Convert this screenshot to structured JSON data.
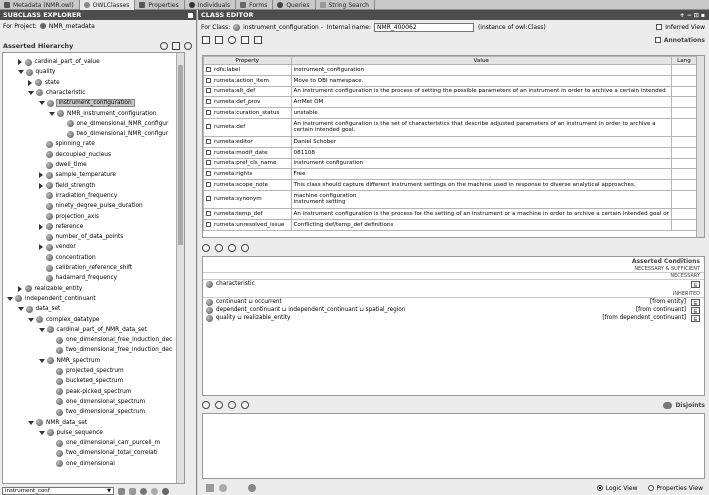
{
  "tabs": [
    {
      "label": "Metadata (NMR.owl)",
      "active": false,
      "icon": "metadata-icon"
    },
    {
      "label": "OWLClasses",
      "active": true,
      "icon": "owlclasses-icon"
    },
    {
      "label": "Properties",
      "active": false,
      "icon": "properties-icon"
    },
    {
      "label": "Individuals",
      "active": false,
      "icon": "individuals-icon"
    },
    {
      "label": "Forms",
      "active": false,
      "icon": "forms-icon"
    },
    {
      "label": "Queries",
      "active": false,
      "icon": "queries-icon"
    },
    {
      "label": "String Search",
      "active": false,
      "icon": "string-search-icon"
    }
  ],
  "left": {
    "title": "SUBCLASS EXPLORER",
    "project_label": "For Project:",
    "project_name": "NMR_metadata",
    "hierarchy_label": "Asserted Hierarchy",
    "search_value": "instrument_conf",
    "tree": [
      {
        "label": "cardinal_part_of_value",
        "depth": 2,
        "toggle": "c"
      },
      {
        "label": "quality",
        "depth": 2,
        "toggle": "e"
      },
      {
        "label": "state",
        "depth": 3,
        "toggle": "c"
      },
      {
        "label": "characteristic",
        "depth": 3,
        "toggle": "e"
      },
      {
        "label": "instrument_configuration",
        "depth": 4,
        "toggle": "e",
        "selected": true
      },
      {
        "label": "NMR_instrument_configuration",
        "depth": 5,
        "toggle": "e"
      },
      {
        "label": "one_dimensional_NMR_configur",
        "depth": 6,
        "toggle": "n"
      },
      {
        "label": "two_dimensional_NMR_configur",
        "depth": 6,
        "toggle": "n"
      },
      {
        "label": "spinning_rate",
        "depth": 4,
        "toggle": "n"
      },
      {
        "label": "decoupled_nucleus",
        "depth": 4,
        "toggle": "n"
      },
      {
        "label": "dwell_time",
        "depth": 4,
        "toggle": "n"
      },
      {
        "label": "sample_temperature",
        "depth": 4,
        "toggle": "c"
      },
      {
        "label": "field_strength",
        "depth": 4,
        "toggle": "c"
      },
      {
        "label": "irradiation_frequency",
        "depth": 4,
        "toggle": "n"
      },
      {
        "label": "ninety_degree_pulse_duration",
        "depth": 4,
        "toggle": "n"
      },
      {
        "label": "projection_axis",
        "depth": 4,
        "toggle": "n"
      },
      {
        "label": "reference",
        "depth": 4,
        "toggle": "c"
      },
      {
        "label": "number_of_data_points",
        "depth": 4,
        "toggle": "n"
      },
      {
        "label": "vendor",
        "depth": 4,
        "toggle": "c"
      },
      {
        "label": "concentration",
        "depth": 4,
        "toggle": "n"
      },
      {
        "label": "calibration_reference_shift",
        "depth": 4,
        "toggle": "n"
      },
      {
        "label": "hadamard_frequency",
        "depth": 4,
        "toggle": "n"
      },
      {
        "label": "realizable_entity",
        "depth": 2,
        "toggle": "c"
      },
      {
        "label": "independent_continuant",
        "depth": 1,
        "toggle": "e"
      },
      {
        "label": "data_set",
        "depth": 2,
        "toggle": "e"
      },
      {
        "label": "complex_datatype",
        "depth": 3,
        "toggle": "e"
      },
      {
        "label": "cardinal_part_of_NMR_data_set",
        "depth": 4,
        "toggle": "e"
      },
      {
        "label": "one_dimensional_free_induction_dec",
        "depth": 5,
        "toggle": "n"
      },
      {
        "label": "two_dimensional_free_induction_dec",
        "depth": 5,
        "toggle": "n"
      },
      {
        "label": "NMR_spectrum",
        "depth": 4,
        "toggle": "e"
      },
      {
        "label": "projected_spectrum",
        "depth": 5,
        "toggle": "n"
      },
      {
        "label": "bucketed_spectrum",
        "depth": 5,
        "toggle": "n"
      },
      {
        "label": "peak-picked_spectrum",
        "depth": 5,
        "toggle": "n"
      },
      {
        "label": "one_dimensional_spectrum",
        "depth": 5,
        "toggle": "n"
      },
      {
        "label": "two_dimensional_spectrum",
        "depth": 5,
        "toggle": "n"
      },
      {
        "label": "NMR_data_set",
        "depth": 3,
        "toggle": "e"
      },
      {
        "label": "pulse_sequence",
        "depth": 4,
        "toggle": "e"
      },
      {
        "label": "one_dimensional_carr_purcell_m",
        "depth": 5,
        "toggle": "n"
      },
      {
        "label": "two_dimensional_total_correlati",
        "depth": 5,
        "toggle": "n"
      },
      {
        "label": "one_dimensional",
        "depth": 5,
        "toggle": "n"
      }
    ]
  },
  "right": {
    "title": "CLASS EDITOR",
    "for_class_label": "For Class:",
    "class_name": "instrument_configuration -",
    "internal_name_label": "Internal name:",
    "internal_name_value": "NMR_400062",
    "instance_of": "(instance of owl:Class)",
    "inferred_view_label": "Inferred View",
    "annotations_label": "Annotations",
    "columns": [
      "Property",
      "Value",
      "Lang"
    ],
    "annotations": [
      {
        "property": "rdfs:label",
        "value": [
          "instrument_configuration"
        ]
      },
      {
        "property": "rumeta:action_item",
        "value": [
          "Move to OBI namespace."
        ]
      },
      {
        "property": "rumeta:alt_def",
        "value": [
          "An instrument configuration is the process of setting the possible parameters of an instrument in order to archive a certain intended"
        ]
      },
      {
        "property": "rumeta:def_prov",
        "value": [
          "ArrMet OM"
        ]
      },
      {
        "property": "rumeta:curation_status",
        "value": [
          "unstable"
        ]
      },
      {
        "property": "rumeta:def",
        "value": [
          "An instrument configuration is the set of characteristics that describe adjusted parameters of an instrument in order to archive a",
          "certain intended goal."
        ]
      },
      {
        "property": "rumeta:editor",
        "value": [
          "Daniel Schober"
        ]
      },
      {
        "property": "rumeta:modif_date",
        "value": [
          "081108"
        ]
      },
      {
        "property": "rumeta:pref_cls_name",
        "value": [
          "instrument configuration"
        ]
      },
      {
        "property": "rumeta:rights",
        "value": [
          "Free"
        ]
      },
      {
        "property": "rumeta:scope_note",
        "value": [
          "This class should capture different instrument settings on the machine used in response to diverse analytical approaches."
        ]
      },
      {
        "property": "rumeta:synonym",
        "value": [
          "machine configuration",
          "instrument setting"
        ]
      },
      {
        "property": "rumeta:temp_def",
        "value": [
          "An instrument configuration is the process for the setting of an instrument or a machine in order to archive a certain intended goal or"
        ]
      },
      {
        "property": "rumeta:unresolved_issue",
        "value": [
          "Conflicting def/temp_def definitions"
        ]
      }
    ],
    "asserted_conditions_label": "Asserted Conditions",
    "necessary_sufficient_label": "NECESSARY & SUFFICIENT",
    "necessary_label": "NECESSARY",
    "inherited_label": "INHERITED",
    "necessary_items": [
      {
        "text": "characteristic"
      }
    ],
    "inherited_items": [
      {
        "text": "continuant ⊔ occurrent",
        "from": "[from entity]"
      },
      {
        "text": "dependent_continuant ⊔ independent_continuant ⊔ spatial_region",
        "from": "[from continuant]"
      },
      {
        "text": "quality ⊔ realizable_entity",
        "from": "[from dependent_continuant]"
      }
    ],
    "disjoints_label": "Disjoints",
    "logic_view_label": "Logic View",
    "properties_view_label": "Properties View"
  }
}
